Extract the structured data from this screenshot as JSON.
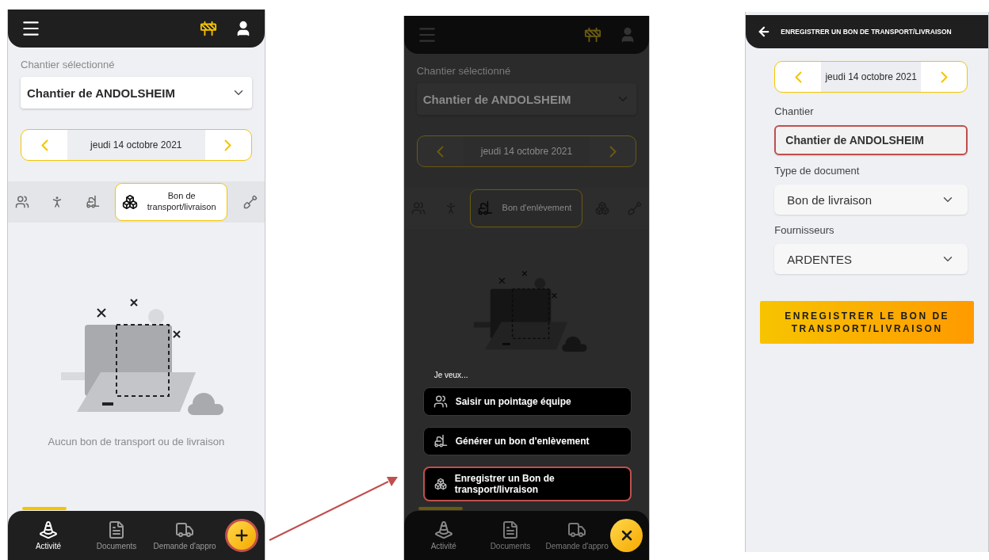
{
  "activity_screen": {
    "site_label": "Chantier sélectionné",
    "site": "Chantier de ANDOLSHEIM",
    "date": "jeudi 14 octobre 2021",
    "tabs": [
      {
        "kind": "team",
        "selected": false
      },
      {
        "kind": "worker",
        "selected": false
      },
      {
        "kind": "pickup",
        "selected": false
      },
      {
        "kind": "delivery",
        "label": "Bon de transport/livraison",
        "selected": true
      },
      {
        "kind": "roadwork",
        "selected": false
      }
    ],
    "empty_message": "Aucun bon de transport ou de livraison",
    "nav": [
      {
        "kind": "cone",
        "label": "Activité",
        "selected": true
      },
      {
        "kind": "document",
        "label": "Documents",
        "selected": false
      },
      {
        "kind": "truck",
        "label": "Demande d'appro",
        "selected": false
      }
    ],
    "fab": {
      "kind": "add",
      "highlighted": true
    }
  },
  "menu_screen": {
    "site_label": "Chantier sélectionné",
    "site": "Chantier de ANDOLSHEIM",
    "date": "jeudi 14 octobre 2021",
    "tabs": [
      {
        "kind": "team",
        "selected": false
      },
      {
        "kind": "worker",
        "selected": false
      },
      {
        "kind": "pickup",
        "label": "Bon d'enlèvement",
        "selected": true
      },
      {
        "kind": "delivery",
        "selected": false
      },
      {
        "kind": "roadwork",
        "selected": false
      }
    ],
    "menu_title": "Je veux...",
    "menu": [
      {
        "kind": "team",
        "label": "Saisir un pointage équipe",
        "highlighted": false
      },
      {
        "kind": "pickup",
        "label": "Générer un bon d'enlèvement",
        "highlighted": false
      },
      {
        "kind": "delivery",
        "label": "Enregistrer un Bon de transport/livraison",
        "highlighted": true
      }
    ],
    "nav": [
      {
        "kind": "cone",
        "label": "Activité",
        "selected": true
      },
      {
        "kind": "document",
        "label": "Documents",
        "selected": false
      },
      {
        "kind": "truck",
        "label": "Demande d'appro",
        "selected": false
      }
    ],
    "fab": {
      "kind": "close",
      "highlighted": false
    }
  },
  "form_screen": {
    "title": "ENREGISTRER UN BON DE TRANSPORT/LIVRAISON",
    "date": "jeudi 14 octobre 2021",
    "fields": [
      {
        "kind": "text",
        "label": "Chantier",
        "value": "Chantier de ANDOLSHEIM",
        "highlighted": true
      },
      {
        "kind": "select",
        "label": "Type de document",
        "value": "Bon de livraison",
        "highlighted": false
      },
      {
        "kind": "select",
        "label": "Fournisseurs",
        "value": "ARDENTES",
        "highlighted": false
      }
    ],
    "submit": "ENREGISTRER LE BON DE TRANSPORT/LIVRAISON"
  }
}
